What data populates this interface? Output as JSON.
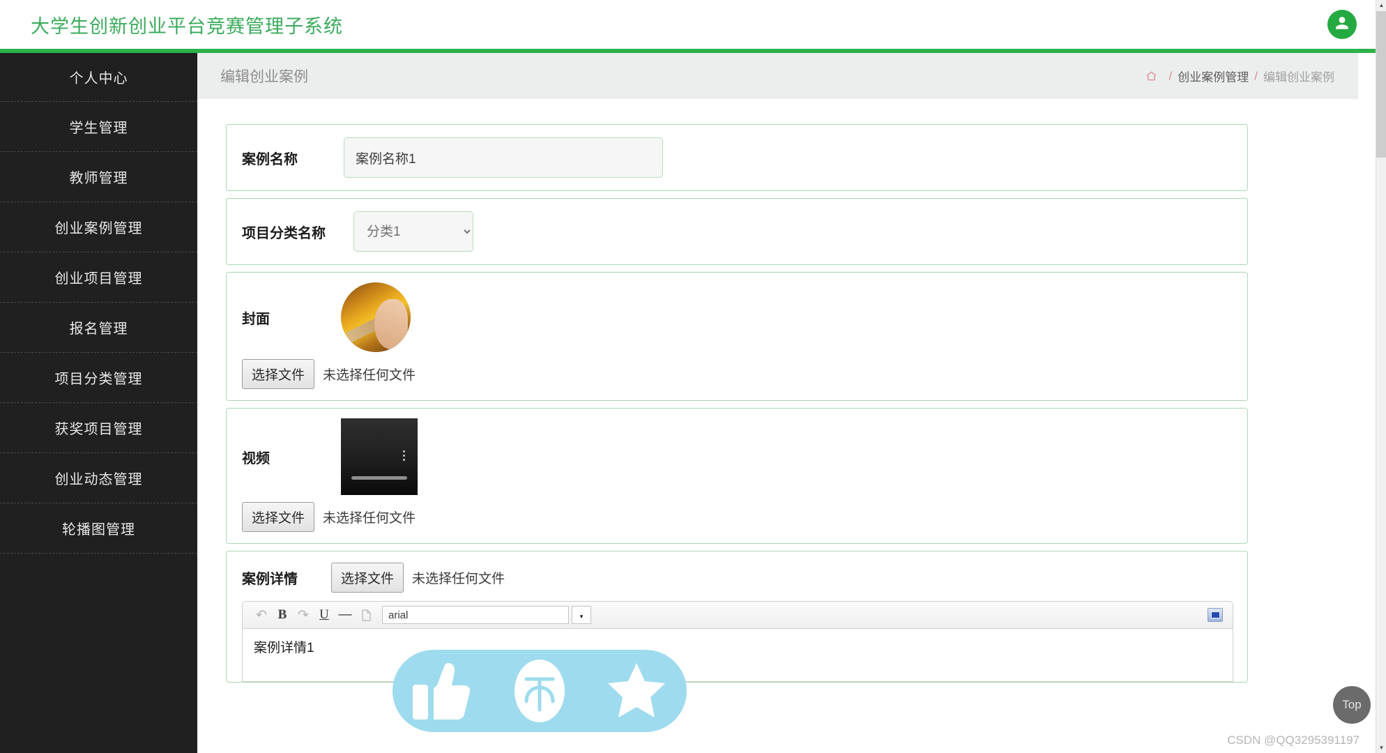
{
  "header": {
    "title": "大学生创新创业平台竞赛管理子系统",
    "avatar_icon": "user-icon",
    "accent_color": "#2db14b",
    "title_color": "#3aab5c"
  },
  "sidebar": {
    "items": [
      {
        "label": "个人中心"
      },
      {
        "label": "学生管理"
      },
      {
        "label": "教师管理"
      },
      {
        "label": "创业案例管理"
      },
      {
        "label": "创业项目管理"
      },
      {
        "label": "报名管理"
      },
      {
        "label": "项目分类管理"
      },
      {
        "label": "获奖项目管理"
      },
      {
        "label": "创业动态管理"
      },
      {
        "label": "轮播图管理"
      }
    ]
  },
  "page": {
    "title": "编辑创业案例",
    "breadcrumb": {
      "home_icon": "home-icon",
      "sep": "/",
      "parent": "创业案例管理",
      "current": "编辑创业案例"
    }
  },
  "form": {
    "case_name": {
      "label": "案例名称",
      "value": "案例名称1"
    },
    "category": {
      "label": "项目分类名称",
      "selected": "分类1",
      "options": [
        "分类1"
      ]
    },
    "cover": {
      "label": "封面",
      "file_button": "选择文件",
      "file_status": "未选择任何文件",
      "thumbnail_icon": "cover-image-thumbnail"
    },
    "video": {
      "label": "视频",
      "file_button": "选择文件",
      "file_status": "未选择任何文件",
      "player_icon": "video-player-thumbnail"
    },
    "detail": {
      "label": "案例详情",
      "file_button": "选择文件",
      "file_status": "未选择任何文件",
      "toolbar": {
        "undo": "↶",
        "bold": "B",
        "redo": "↷",
        "underline": "U",
        "strike": "—",
        "page": "page-icon",
        "font_name": "arial",
        "fullscreen_icon": "fullscreen-icon"
      },
      "content": "案例详情1"
    }
  },
  "overlay": {
    "like_icon": "thumbs-up-icon",
    "reward_icon": "coin-reward-icon",
    "favorite_icon": "star-icon",
    "pill_color": "#9edbee"
  },
  "footer": {
    "top_button": "Top",
    "watermark": "CSDN @QQ3295391197"
  },
  "scrollbar": {
    "up_arrow": "▲",
    "down_arrow": "▼"
  }
}
